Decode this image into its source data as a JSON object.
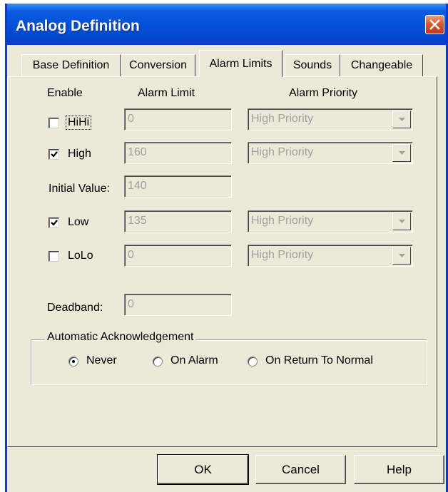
{
  "window": {
    "title": "Analog Definition"
  },
  "tabs": [
    {
      "label": "Base Definition",
      "active": false
    },
    {
      "label": "Conversion",
      "active": false
    },
    {
      "label": "Alarm Limits",
      "active": true
    },
    {
      "label": "Sounds",
      "active": false
    },
    {
      "label": "Changeable",
      "active": false
    }
  ],
  "headers": {
    "enable": "Enable",
    "alarm_limit": "Alarm Limit",
    "alarm_priority": "Alarm Priority"
  },
  "rows": {
    "hihi": {
      "label": "HiHi",
      "checked": false,
      "value": "0",
      "priority": "High Priority"
    },
    "high": {
      "label": "High",
      "checked": true,
      "value": "160",
      "priority": "High Priority"
    },
    "initial": {
      "label": "Initial Value:",
      "value": "140"
    },
    "low": {
      "label": "Low",
      "checked": true,
      "value": "135",
      "priority": "High Priority"
    },
    "lolo": {
      "label": "LoLo",
      "checked": false,
      "value": "0",
      "priority": "High Priority"
    }
  },
  "deadband": {
    "label": "Deadband:",
    "value": "0"
  },
  "ack": {
    "title": "Automatic Acknowledgement",
    "options": [
      {
        "label": "Never",
        "selected": true
      },
      {
        "label": "On Alarm",
        "selected": false
      },
      {
        "label": "On Return To Normal",
        "selected": false
      }
    ]
  },
  "buttons": {
    "ok": "OK",
    "cancel": "Cancel",
    "help": "Help"
  },
  "icons": {
    "close": "close-icon",
    "check": "check-icon",
    "dropdown": "chevron-down-icon"
  }
}
